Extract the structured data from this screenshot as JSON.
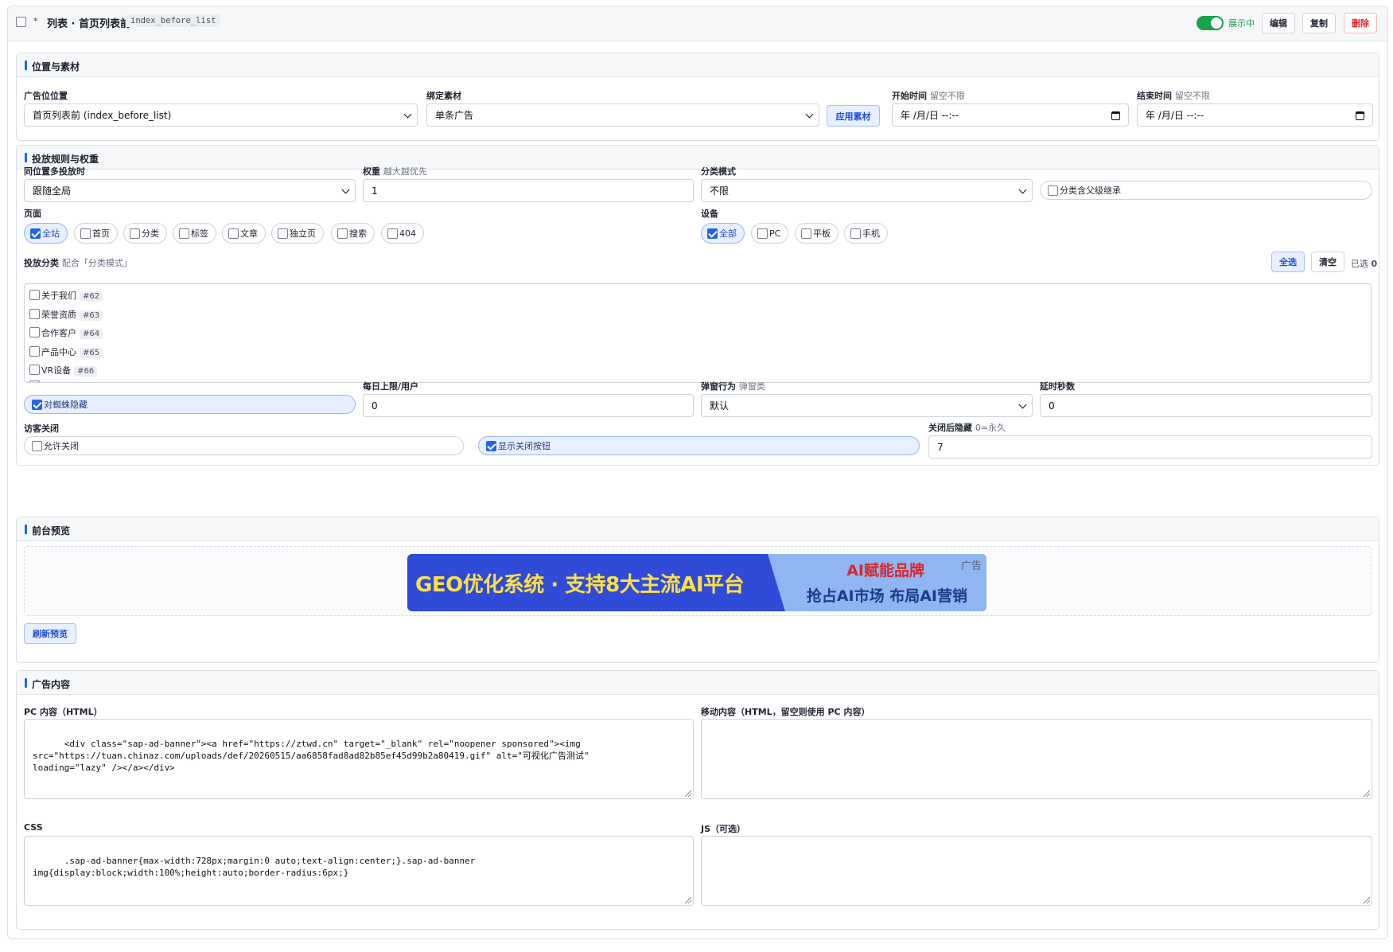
{
  "header": {
    "star": "*",
    "title": "列表 · 首页列表前",
    "code": "index_before_list",
    "status_label": "展示中",
    "edit_label": "编辑",
    "copy_label": "复制",
    "delete_label": "删除"
  },
  "position_section": {
    "title": "位置与素材",
    "slot_label": "广告位位置",
    "slot_value": "首页列表前 (index_before_list)",
    "material_label": "绑定素材",
    "material_value": "单条广告",
    "apply_label": "应用素材",
    "start_label": "开始时间",
    "start_hint": "留空不限",
    "start_value": "年 /月/日 --:--",
    "end_label": "结束时间",
    "end_hint": "留空不限",
    "end_value": "年 /月/日 --:--"
  },
  "rules_section": {
    "title": "投放规则与权重",
    "multi_label": "同位置多投放时",
    "multi_value": "跟随全局",
    "weight_label": "权重",
    "weight_hint": "越大越优先",
    "weight_value": "1",
    "cat_mode_label": "分类模式",
    "cat_mode_value": "不限",
    "inherit_label": "分类含父级继承",
    "pages_label": "页面",
    "pages": [
      {
        "label": "全站",
        "checked": true
      },
      {
        "label": "首页",
        "checked": false
      },
      {
        "label": "分类",
        "checked": false
      },
      {
        "label": "标签",
        "checked": false
      },
      {
        "label": "文章",
        "checked": false
      },
      {
        "label": "独立页",
        "checked": false
      },
      {
        "label": "搜索",
        "checked": false
      },
      {
        "label": "404",
        "checked": false
      }
    ],
    "devices_label": "设备",
    "devices": [
      {
        "label": "全部",
        "checked": true
      },
      {
        "label": "PC",
        "checked": false
      },
      {
        "label": "平板",
        "checked": false
      },
      {
        "label": "手机",
        "checked": false
      }
    ],
    "categories_label": "投放分类",
    "categories_hint": "配合「分类模式」",
    "select_all_label": "全选",
    "clear_label": "清空",
    "selected_count_text": "已选",
    "selected_count": "0",
    "categories": [
      {
        "name": "关于我们",
        "id": "#62"
      },
      {
        "name": "荣誉资质",
        "id": "#63"
      },
      {
        "name": "合作客户",
        "id": "#64"
      },
      {
        "name": "产品中心",
        "id": "#65"
      },
      {
        "name": "VR设备",
        "id": "#66"
      }
    ],
    "spider_label": "对蜘蛛隐藏",
    "daily_label": "每日上限/用户",
    "daily_value": "0",
    "popup_label": "弹窗行为",
    "popup_hint": "弹窗类",
    "popup_value": "默认",
    "delay_label": "延时秒数",
    "delay_value": "0",
    "visitor_close_label": "访客关闭",
    "allow_close_label": "允许关闭",
    "show_close_label": "显示关闭按钮",
    "hide_after_label": "关闭后隐藏",
    "hide_after_hint": "0=永久",
    "hide_after_value": "7"
  },
  "preview_section": {
    "title": "前台预览",
    "banner_main": "GEO优化系统 · 支持8大主流AI平台",
    "banner_line1": "AI赋能品牌",
    "banner_line2": "抢占AI市场 布局AI营销",
    "banner_tag": "广告",
    "refresh_label": "刷新预览"
  },
  "content_section": {
    "title": "广告内容",
    "pc_label": "PC 内容（HTML）",
    "pc_value": "<div class=\"sap-ad-banner\"><a href=\"https://ztwd.cn\" target=\"_blank\" rel=\"noopener sponsored\"><img\nsrc=\"https://tuan.chinaz.com/uploads/def/20260515/aa6858fad8ad82b85ef45d99b2a80419.gif\" alt=\"可视化广告测试\"\nloading=\"lazy\" /></a></div>",
    "mobile_label": "移动内容（HTML，留空则使用 PC 内容）",
    "mobile_value": "",
    "css_label": "CSS",
    "css_value": ".sap-ad-banner{max-width:728px;margin:0 auto;text-align:center;}.sap-ad-banner\nimg{display:block;width:100%;height:auto;border-radius:6px;}",
    "js_label": "JS（可选）",
    "js_value": ""
  },
  "colors": {
    "accent": "#2563eb",
    "success": "#16a34a",
    "danger": "#dc2626"
  }
}
